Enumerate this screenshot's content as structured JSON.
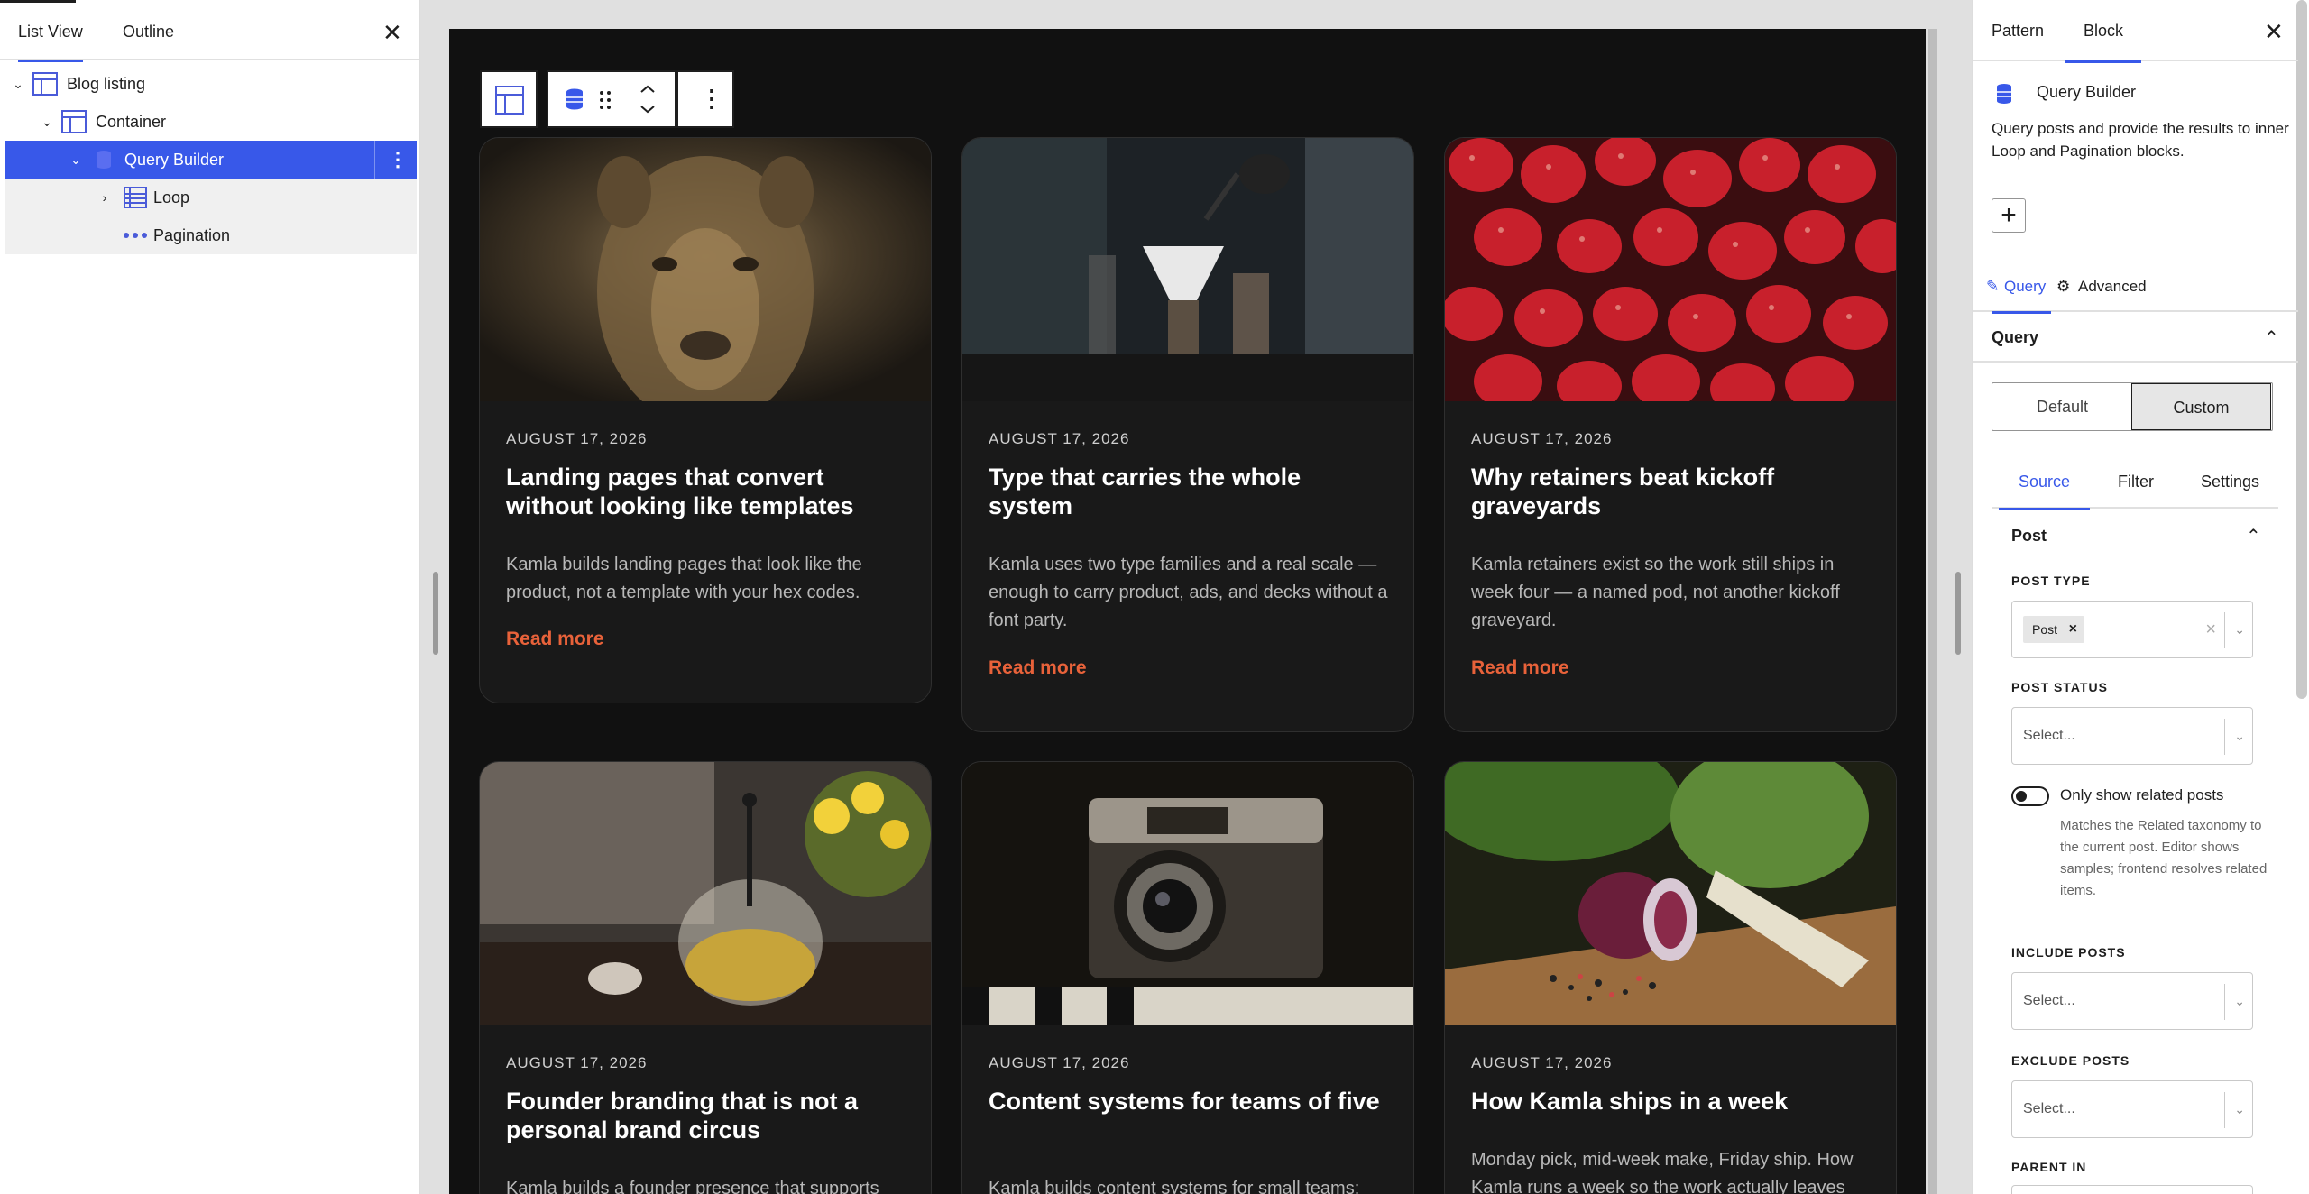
{
  "left_panel": {
    "tabs": [
      "List View",
      "Outline"
    ],
    "tree": [
      {
        "label": "Blog listing"
      },
      {
        "label": "Container"
      },
      {
        "label": "Query Builder"
      },
      {
        "label": "Loop"
      },
      {
        "label": "Pagination"
      }
    ]
  },
  "cards": [
    {
      "date": "AUGUST 17, 2026",
      "title": "Landing pages that convert without looking like templates",
      "excerpt": "Kamla builds landing pages that look like the product, not a template with your hex codes.",
      "read_more": "Read more"
    },
    {
      "date": "AUGUST 17, 2026",
      "title": "Type that carries the whole system",
      "excerpt": "Kamla uses two type families and a real scale — enough to carry product, ads, and decks without a font party.",
      "read_more": "Read more"
    },
    {
      "date": "AUGUST 17, 2026",
      "title": "Why retainers beat kickoff graveyards",
      "excerpt": "Kamla retainers exist so the work still ships in week four — a named pod, not another kickoff graveyard.",
      "read_more": "Read more"
    },
    {
      "date": "AUGUST 17, 2026",
      "title": "Founder branding that is not a personal brand circus",
      "excerpt": "Kamla builds a founder presence that supports",
      "read_more": ""
    },
    {
      "date": "AUGUST 17, 2026",
      "title": "Content systems for teams of five",
      "excerpt": "Kamla builds content systems for small teams;",
      "read_more": ""
    },
    {
      "date": "AUGUST 17, 2026",
      "title": "How Kamla ships in a week",
      "excerpt": "Monday pick, mid-week make, Friday ship. How Kamla runs a week so the work actually leaves",
      "read_more": ""
    }
  ],
  "right_panel": {
    "tabs": [
      "Pattern",
      "Block"
    ],
    "block_name": "Query Builder",
    "block_description": "Query posts and provide the results to inner Loop and Pagination blocks.",
    "sub_tabs": [
      "Query",
      "Advanced"
    ],
    "section_title": "Query",
    "segmented": [
      "Default",
      "Custom"
    ],
    "source_tabs": [
      "Source",
      "Filter",
      "Settings"
    ],
    "post_group": "Post",
    "post_type_label": "POST TYPE",
    "post_type_chip": "Post",
    "post_status_label": "POST STATUS",
    "select_placeholder": "Select...",
    "toggle_label": "Only show related posts",
    "toggle_help": "Matches the Related taxonomy to the current post. Editor shows samples; frontend resolves related items.",
    "include_label": "INCLUDE POSTS",
    "exclude_label": "EXCLUDE POSTS",
    "parent_label": "PARENT IN"
  },
  "colors": {
    "accent": "#3858e9",
    "read_more": "#e8623a",
    "canvas_bg": "#111111"
  }
}
